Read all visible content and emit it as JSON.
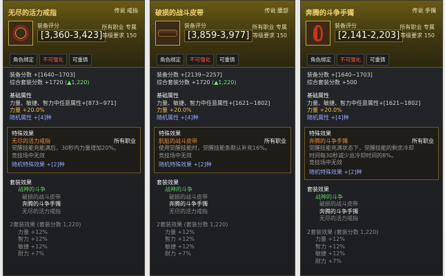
{
  "panels": [
    {
      "title": "无尽的活力戒指",
      "rarity": "传说 戒指",
      "score_label": "装备评分",
      "score_value": "[3,360-3,423]",
      "prof_line1": "所有职业 专属",
      "prof_line2": "等级要求 150",
      "tags": [
        "角色绑定",
        "不可强化",
        "可重铸"
      ],
      "gear_score": "装备分数 +[1640~1703]",
      "set_score": "综合套装分数 +1720",
      "set_score_delta": "(▲1,220)",
      "basic_header": "基础属性",
      "stat_line": "力量、敏捷、智力中任意属性+[873~971]",
      "power": "力量 +20.0%",
      "random_attr": "随机属性 +[4]种",
      "special_header": "特殊效果",
      "special_name": "无尽的活力戒指",
      "special_prof": "所有职业",
      "special_desc1": "觉醒技能充能满后，30秒内力量增加20%。",
      "special_desc2": "竞技场中无效",
      "random_special": "随机特殊效果 +[2]种",
      "set_header": "套装效果",
      "set_name": "战神的斗争",
      "set_items": [
        "破损的战斗皮带",
        "奔腾的斗争手镯",
        "无尽的活力戒指"
      ],
      "set_bonus_header": "2套装效果 (套装分数 1,220)",
      "set_bonus": [
        "力量 +12%",
        "智力 +12%",
        "敏捷 +12%",
        "耐力 +7%"
      ]
    },
    {
      "title": "破损的战斗皮带",
      "rarity": "传说 腰部",
      "score_label": "装备评分",
      "score_value": "[3,859-3,977]",
      "prof_line1": "所有职业 专属",
      "prof_line2": "等级要求 150",
      "tags": [
        "角色绑定",
        "不可强化",
        "可重铸"
      ],
      "gear_score": "装备分数 +[2139~2257]",
      "set_score": "综合套装分数 +1720",
      "set_score_delta": "(▲1,220)",
      "basic_header": "基础属性",
      "stat_line": "力量、敏捷、智力中任意属性+[1621~1802]",
      "power": "力量 +20.0%",
      "random_attr": "随机属性 +[4]种",
      "special_header": "特殊效果",
      "special_name": "肮脏的战斗皮带",
      "special_prof": "所有职业",
      "special_desc1": "使用觉醒技能时，觉醒技能条默认补充16%。",
      "special_desc2": "竞技场中无效",
      "random_special": "随机特殊效果 +[2]种",
      "set_header": "套装效果",
      "set_name": "战神的斗争",
      "set_items": [
        "破损的战斗皮带",
        "奔腾的斗争手镯",
        "无尽的活力戒指"
      ],
      "set_bonus_header": "2套装效果 (套装分数 1,220)",
      "set_bonus": [
        "力量 +12%",
        "智力 +12%",
        "敏捷 +12%",
        "耐力 +7%"
      ]
    },
    {
      "title": "奔腾的斗争手镯",
      "rarity": "传说 手镯",
      "score_label": "装备评分",
      "score_value": "[2,141-2,203]",
      "prof_line1": "所有职业 专属",
      "prof_line2": "等级要求 150",
      "tags": [
        "角色绑定",
        "不可强化",
        "可重铸"
      ],
      "gear_score": "装备分数 +[1640~1703]",
      "set_score": "综合套装分数 +500",
      "set_score_delta": "",
      "basic_header": "基础属性",
      "stat_line": "力量、敏捷、智力中任意属性+[1621~1802]",
      "power": "力量 +20.0%",
      "random_attr": "随机属性 +[4]种",
      "special_header": "特殊效果",
      "special_name": "奔腾的斗争手镯",
      "special_prof": "所有职业",
      "special_desc1": "觉醒技能充满状态下，觉醒技能的剩余冷却",
      "special_desc1b": "时间每30秒减少总冷却时间的8%。",
      "special_desc2": "竞技场中无效",
      "random_special": "随机特殊效果 +[2]种",
      "set_header": "套装效果",
      "set_name": "战神的斗争",
      "set_items": [
        "破损的战斗皮带",
        "奔腾的斗争手镯",
        "无尽的活力戒指"
      ],
      "set_bonus_header": "2套装效果 (套装分数 1,220)",
      "set_bonus": [
        "力量 +12%",
        "智力 +12%",
        "敏捷 +12%",
        "耐力 +7%"
      ]
    }
  ],
  "colors": {
    "header_gold": "#f2d57a",
    "set_name_green": "#5fd05f",
    "power_yellow": "#e8c04a",
    "random_blue": "#93a7ff",
    "special_orange": "#e98b3a"
  },
  "icons": [
    "ring-icon",
    "belt-icon",
    "bracer-icon"
  ]
}
